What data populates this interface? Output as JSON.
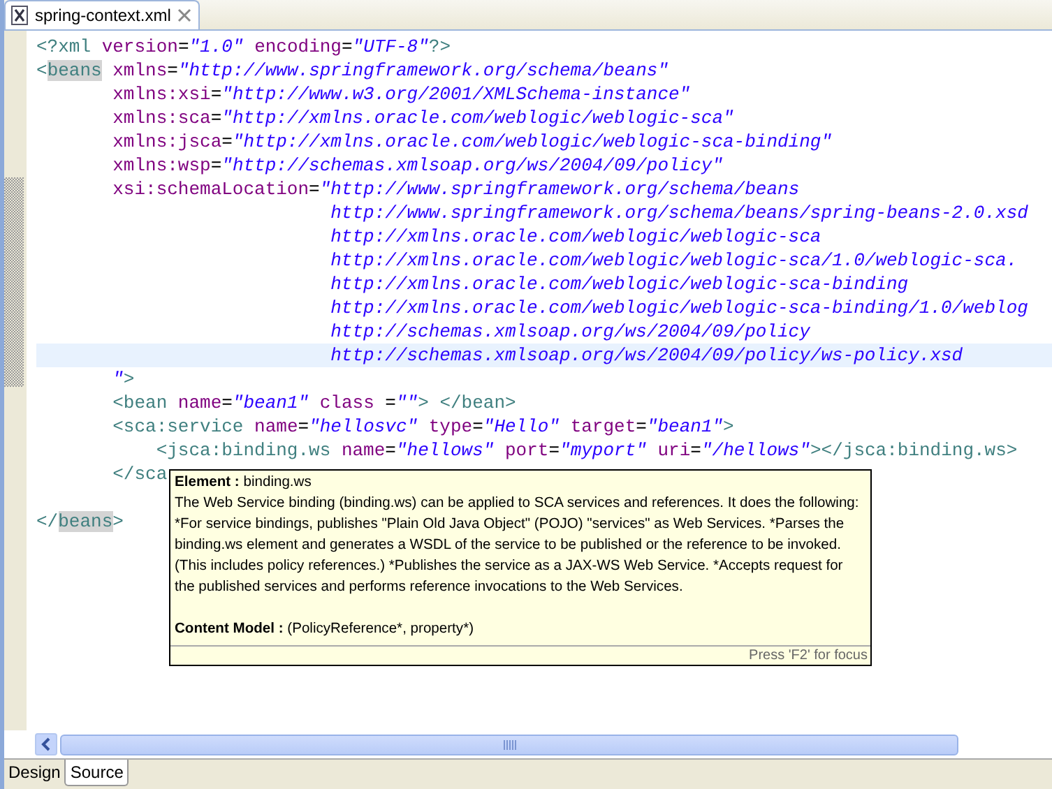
{
  "editor_tab": {
    "title": "spring-context.xml",
    "selected": true
  },
  "lines": [
    {
      "current": false,
      "segments": [
        {
          "kind": "tag",
          "text": "<?xml"
        },
        {
          "kind": "attr",
          "text": " version"
        },
        {
          "kind": "eq",
          "text": "="
        },
        {
          "kind": "value",
          "text": "\"1.0\""
        },
        {
          "kind": "attr",
          "text": " encoding"
        },
        {
          "kind": "eq",
          "text": "="
        },
        {
          "kind": "value",
          "text": "\"UTF-8\""
        },
        {
          "kind": "tag",
          "text": "?>"
        }
      ]
    },
    {
      "current": false,
      "segments": [
        {
          "kind": "tag",
          "text": "<"
        },
        {
          "kind": "marked",
          "text": "beans"
        },
        {
          "kind": "attr",
          "text": " xmlns"
        },
        {
          "kind": "eq",
          "text": "="
        },
        {
          "kind": "value",
          "text": "\"http://www.springframework.org/schema/beans\""
        }
      ]
    },
    {
      "current": false,
      "segments": [
        {
          "kind": "attr",
          "text": "       xmlns:xsi"
        },
        {
          "kind": "eq",
          "text": "="
        },
        {
          "kind": "value",
          "text": "\"http://www.w3.org/2001/XMLSchema-instance\""
        }
      ]
    },
    {
      "current": false,
      "segments": [
        {
          "kind": "attr",
          "text": "       xmlns:sca"
        },
        {
          "kind": "eq",
          "text": "="
        },
        {
          "kind": "value",
          "text": "\"http://xmlns.oracle.com/weblogic/weblogic-sca\""
        }
      ]
    },
    {
      "current": false,
      "segments": [
        {
          "kind": "attr",
          "text": "       xmlns:jsca"
        },
        {
          "kind": "eq",
          "text": "="
        },
        {
          "kind": "value",
          "text": "\"http://xmlns.oracle.com/weblogic/weblogic-sca-binding\""
        }
      ]
    },
    {
      "current": false,
      "segments": [
        {
          "kind": "attr",
          "text": "       xmlns:wsp"
        },
        {
          "kind": "eq",
          "text": "="
        },
        {
          "kind": "value",
          "text": "\"http://schemas.xmlsoap.org/ws/2004/09/policy\""
        }
      ]
    },
    {
      "current": false,
      "segments": [
        {
          "kind": "attr",
          "text": "       xsi:schemaLocation"
        },
        {
          "kind": "eq",
          "text": "="
        },
        {
          "kind": "value",
          "text": "\"http://www.springframework.org/schema/beans"
        }
      ]
    },
    {
      "current": false,
      "segments": [
        {
          "kind": "value",
          "text": "                           http://www.springframework.org/schema/beans/spring-beans-2.0.xsd"
        }
      ]
    },
    {
      "current": false,
      "segments": [
        {
          "kind": "value",
          "text": "                           http://xmlns.oracle.com/weblogic/weblogic-sca"
        }
      ]
    },
    {
      "current": false,
      "segments": [
        {
          "kind": "value",
          "text": "                           http://xmlns.oracle.com/weblogic/weblogic-sca/1.0/weblogic-sca."
        }
      ]
    },
    {
      "current": false,
      "segments": [
        {
          "kind": "value",
          "text": "                           http://xmlns.oracle.com/weblogic/weblogic-sca-binding"
        }
      ]
    },
    {
      "current": false,
      "segments": [
        {
          "kind": "value",
          "text": "                           http://xmlns.oracle.com/weblogic/weblogic-sca-binding/1.0/weblog"
        }
      ]
    },
    {
      "current": false,
      "segments": [
        {
          "kind": "value",
          "text": "                           http://schemas.xmlsoap.org/ws/2004/09/policy"
        }
      ]
    },
    {
      "current": true,
      "segments": [
        {
          "kind": "value",
          "text": "                           http://schemas.xmlsoap.org/ws/2004/09/policy/ws-policy.xsd"
        }
      ]
    },
    {
      "current": false,
      "segments": [
        {
          "kind": "value",
          "text": "       \""
        },
        {
          "kind": "tag",
          "text": ">"
        }
      ]
    },
    {
      "current": false,
      "segments": [
        {
          "kind": "tag",
          "text": "       <bean"
        },
        {
          "kind": "attr",
          "text": " name"
        },
        {
          "kind": "eq",
          "text": "="
        },
        {
          "kind": "value",
          "text": "\"bean1\""
        },
        {
          "kind": "attr",
          "text": " class"
        },
        {
          "kind": "eq",
          "text": " ="
        },
        {
          "kind": "value",
          "text": "\"\""
        },
        {
          "kind": "tag",
          "text": "> </bean>"
        }
      ]
    },
    {
      "current": false,
      "segments": [
        {
          "kind": "tag",
          "text": "       <sca:service"
        },
        {
          "kind": "attr",
          "text": " name"
        },
        {
          "kind": "eq",
          "text": "="
        },
        {
          "kind": "value",
          "text": "\"hellosvc\""
        },
        {
          "kind": "attr",
          "text": " type"
        },
        {
          "kind": "eq",
          "text": "="
        },
        {
          "kind": "value",
          "text": "\"Hello\""
        },
        {
          "kind": "attr",
          "text": " target"
        },
        {
          "kind": "eq",
          "text": "="
        },
        {
          "kind": "value",
          "text": "\"bean1\""
        },
        {
          "kind": "tag",
          "text": ">"
        }
      ]
    },
    {
      "current": false,
      "segments": [
        {
          "kind": "tag",
          "text": "           <jsca:binding.ws"
        },
        {
          "kind": "attr",
          "text": " name"
        },
        {
          "kind": "eq",
          "text": "="
        },
        {
          "kind": "value",
          "text": "\"hellows\""
        },
        {
          "kind": "attr",
          "text": " port"
        },
        {
          "kind": "eq",
          "text": "="
        },
        {
          "kind": "value",
          "text": "\"myport\""
        },
        {
          "kind": "attr",
          "text": " uri"
        },
        {
          "kind": "eq",
          "text": "="
        },
        {
          "kind": "value",
          "text": "\"/hellows\""
        },
        {
          "kind": "tag",
          "text": "></jsca:binding.ws>"
        }
      ]
    },
    {
      "current": false,
      "segments": [
        {
          "kind": "tag",
          "text": "       </sca"
        }
      ]
    },
    {
      "current": false
    },
    {
      "current": false,
      "segments": [
        {
          "kind": "tag",
          "text": "</"
        },
        {
          "kind": "marked",
          "text": "beans"
        },
        {
          "kind": "tag",
          "text": ">"
        }
      ]
    }
  ],
  "hover_info": {
    "heading": "**Element :** binding.ws",
    "description": "The Web Service binding (binding.ws) can be applied to SCA services and references. It does the following: *For service bindings, publishes \"Plain Old Java Object\" (POJO) \"services\" as Web Services. *Parses the binding.ws element and generates a WSDL of the service to be published or the reference to be invoked. (This includes policy references.) *Publishes the service as a JAX-WS Web Service. *Accepts request for the published services and performs reference invocations to the Web Services.",
    "content_model": "**Content Model :** (PolicyReference*, property*)",
    "hint": "Press 'F2' for focus"
  },
  "bottom_tabs": [
    {
      "label": "Design",
      "selected": false
    },
    {
      "label": "Source",
      "selected": true
    }
  ]
}
